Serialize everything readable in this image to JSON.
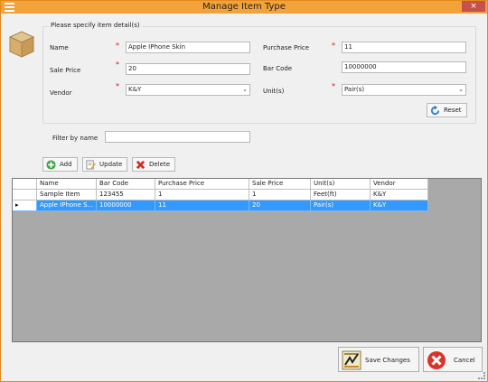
{
  "window": {
    "title": "Manage Item Type",
    "close_glyph": "×"
  },
  "details": {
    "legend": "Please specify item detail(s)",
    "name_label": "Name",
    "name_value": "Apple IPhone Skin",
    "sale_price_label": "Sale Price",
    "sale_price_value": "20",
    "vendor_label": "Vendor",
    "vendor_value": "K&Y",
    "purchase_price_label": "Purchase Price",
    "purchase_price_value": "11",
    "bar_code_label": "Bar Code",
    "bar_code_value": "10000000",
    "units_label": "Unit(s)",
    "units_value": "Pair(s)",
    "required_mark": "*",
    "reset_label": "Reset"
  },
  "filter": {
    "label": "Filter by name",
    "value": ""
  },
  "toolbar": {
    "add_label": "Add",
    "update_label": "Update",
    "delete_label": "Delete"
  },
  "grid": {
    "columns": [
      "Name",
      "Bar Code",
      "Purchase Price",
      "Sale Price",
      "Unit(s)",
      "Vendor"
    ],
    "rows": [
      {
        "indicator": "",
        "cells": [
          "Sample Item",
          "123455",
          "1",
          "1",
          "Feet(ft)",
          "K&Y"
        ]
      },
      {
        "indicator": "▸",
        "cells": [
          "Apple IPhone S...",
          "10000000",
          "11",
          "20",
          "Pair(s)",
          "K&Y"
        ]
      }
    ]
  },
  "footer": {
    "save_label": "Save Changes",
    "cancel_label": "Cancel"
  },
  "colors": {
    "title_bar": "#f3a23a",
    "selection": "#3399ff",
    "grid_bg": "#a9a9a9",
    "close": "#c7504a"
  },
  "icons": [
    "menu-icon",
    "box-icon",
    "reset-icon",
    "add-icon",
    "update-icon",
    "delete-icon",
    "save-icon",
    "cancel-icon",
    "chevron-down-icon",
    "row-indicator-icon"
  ]
}
